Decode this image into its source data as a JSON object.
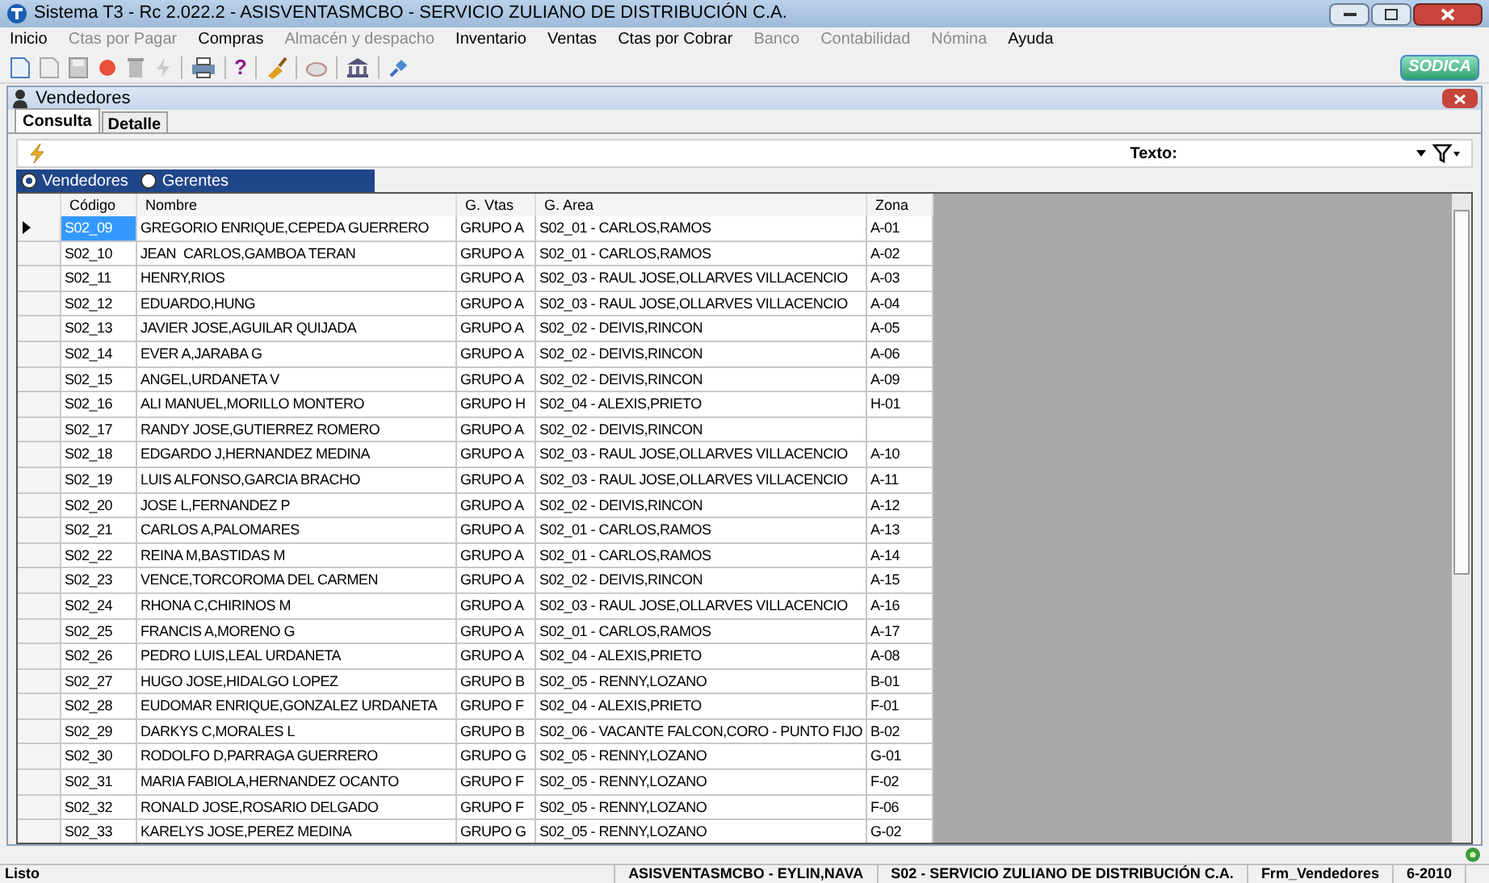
{
  "window": {
    "title": "Sistema T3 - Rc 2.022.2 - ASISVENTASMCBO - SERVICIO ZULIANO DE DISTRIBUCIÓN C.A."
  },
  "menu": [
    {
      "label": "Inicio",
      "disabled": false
    },
    {
      "label": "Ctas por Pagar",
      "disabled": true
    },
    {
      "label": "Compras",
      "disabled": false
    },
    {
      "label": "Almacén y despacho",
      "disabled": true
    },
    {
      "label": "Inventario",
      "disabled": false
    },
    {
      "label": "Ventas",
      "disabled": false
    },
    {
      "label": "Ctas por Cobrar",
      "disabled": false
    },
    {
      "label": "Banco",
      "disabled": true
    },
    {
      "label": "Contabilidad",
      "disabled": true
    },
    {
      "label": "Nómina",
      "disabled": true
    },
    {
      "label": "Ayuda",
      "disabled": false
    }
  ],
  "toolbar": {
    "help": "?"
  },
  "brand": "SODICA",
  "child_window": {
    "title": "Vendedores"
  },
  "tabs": [
    {
      "label": "Consulta",
      "selected": true
    },
    {
      "label": "Detalle",
      "selected": false
    }
  ],
  "search": {
    "label": "Texto:"
  },
  "filter_options": [
    {
      "label": "Vendedores",
      "selected": true
    },
    {
      "label": "Gerentes",
      "selected": false
    }
  ],
  "table": {
    "columns": [
      "Código",
      "Nombre",
      "G. Vtas",
      "G. Area",
      "Zona"
    ],
    "rows": [
      {
        "cells": [
          "S02_09",
          "GREGORIO ENRIQUE,CEPEDA GUERRERO",
          "GRUPO A",
          "S02_01 - CARLOS,RAMOS",
          "A-01"
        ],
        "selected": true
      },
      {
        "cells": [
          "S02_10",
          "JEAN  CARLOS,GAMBOA TERAN",
          "GRUPO A",
          "S02_01 - CARLOS,RAMOS",
          "A-02"
        ],
        "selected": false
      },
      {
        "cells": [
          "S02_11",
          "HENRY,RIOS",
          "GRUPO A",
          "S02_03 - RAUL JOSE,OLLARVES VILLACENCIO",
          "A-03"
        ],
        "selected": false
      },
      {
        "cells": [
          "S02_12",
          "EDUARDO,HUNG",
          "GRUPO A",
          "S02_03 - RAUL JOSE,OLLARVES VILLACENCIO",
          "A-04"
        ],
        "selected": false
      },
      {
        "cells": [
          "S02_13",
          "JAVIER JOSE,AGUILAR QUIJADA",
          "GRUPO A",
          "S02_02 - DEIVIS,RINCON",
          "A-05"
        ],
        "selected": false
      },
      {
        "cells": [
          "S02_14",
          "EVER A,JARABA G",
          "GRUPO A",
          "S02_02 - DEIVIS,RINCON",
          "A-06"
        ],
        "selected": false
      },
      {
        "cells": [
          "S02_15",
          "ANGEL,URDANETA V",
          "GRUPO A",
          "S02_02 - DEIVIS,RINCON",
          "A-09"
        ],
        "selected": false
      },
      {
        "cells": [
          "S02_16",
          "ALI MANUEL,MORILLO MONTERO",
          "GRUPO H",
          "S02_04 - ALEXIS,PRIETO",
          "H-01"
        ],
        "selected": false
      },
      {
        "cells": [
          "S02_17",
          "RANDY JOSE,GUTIERREZ ROMERO",
          "GRUPO A",
          "S02_02 - DEIVIS,RINCON",
          ""
        ],
        "selected": false
      },
      {
        "cells": [
          "S02_18",
          "EDGARDO J,HERNANDEZ MEDINA",
          "GRUPO A",
          "S02_03 - RAUL JOSE,OLLARVES VILLACENCIO",
          "A-10"
        ],
        "selected": false
      },
      {
        "cells": [
          "S02_19",
          "LUIS ALFONSO,GARCIA BRACHO",
          "GRUPO A",
          "S02_03 - RAUL JOSE,OLLARVES VILLACENCIO",
          "A-11"
        ],
        "selected": false
      },
      {
        "cells": [
          "S02_20",
          "JOSE L,FERNANDEZ P",
          "GRUPO A",
          "S02_02 - DEIVIS,RINCON",
          "A-12"
        ],
        "selected": false
      },
      {
        "cells": [
          "S02_21",
          "CARLOS A,PALOMARES",
          "GRUPO A",
          "S02_01 - CARLOS,RAMOS",
          "A-13"
        ],
        "selected": false
      },
      {
        "cells": [
          "S02_22",
          "REINA M,BASTIDAS M",
          "GRUPO A",
          "S02_01 - CARLOS,RAMOS",
          "A-14"
        ],
        "selected": false
      },
      {
        "cells": [
          "S02_23",
          "VENCE,TORCOROMA DEL CARMEN",
          "GRUPO A",
          "S02_02 - DEIVIS,RINCON",
          "A-15"
        ],
        "selected": false
      },
      {
        "cells": [
          "S02_24",
          "RHONA C,CHIRINOS M",
          "GRUPO A",
          "S02_03 - RAUL JOSE,OLLARVES VILLACENCIO",
          "A-16"
        ],
        "selected": false
      },
      {
        "cells": [
          "S02_25",
          "FRANCIS A,MORENO G",
          "GRUPO A",
          "S02_01 - CARLOS,RAMOS",
          "A-17"
        ],
        "selected": false
      },
      {
        "cells": [
          "S02_26",
          "PEDRO LUIS,LEAL URDANETA",
          "GRUPO A",
          "S02_04 - ALEXIS,PRIETO",
          "A-08"
        ],
        "selected": false
      },
      {
        "cells": [
          "S02_27",
          "HUGO JOSE,HIDALGO LOPEZ",
          "GRUPO B",
          "S02_05 - RENNY,LOZANO",
          "B-01"
        ],
        "selected": false
      },
      {
        "cells": [
          "S02_28",
          "EUDOMAR ENRIQUE,GONZALEZ URDANETA",
          "GRUPO F",
          "S02_04 - ALEXIS,PRIETO",
          "F-01"
        ],
        "selected": false
      },
      {
        "cells": [
          "S02_29",
          "DARKYS C,MORALES L",
          "GRUPO B",
          "S02_06 - VACANTE FALCON,CORO - PUNTO FIJO",
          "B-02"
        ],
        "selected": false
      },
      {
        "cells": [
          "S02_30",
          "RODOLFO D,PARRAGA GUERRERO",
          "GRUPO G",
          "S02_05 - RENNY,LOZANO",
          "G-01"
        ],
        "selected": false
      },
      {
        "cells": [
          "S02_31",
          "MARIA FABIOLA,HERNANDEZ OCANTO",
          "GRUPO F",
          "S02_05 - RENNY,LOZANO",
          "F-02"
        ],
        "selected": false
      },
      {
        "cells": [
          "S02_32",
          "RONALD JOSE,ROSARIO DELGADO",
          "GRUPO F",
          "S02_05 - RENNY,LOZANO",
          "F-06"
        ],
        "selected": false
      },
      {
        "cells": [
          "S02_33",
          "KARELYS JOSE,PEREZ MEDINA",
          "GRUPO G",
          "S02_05 - RENNY,LOZANO",
          "G-02"
        ],
        "selected": false
      }
    ]
  },
  "status_bar": [
    "Listo",
    "ASISVENTASMCBO - EYLIN,NAVA",
    "S02 - SERVICIO ZULIANO DE DISTRIBUCIÓN C.A.",
    "Frm_Vendedores",
    "6-2010"
  ]
}
